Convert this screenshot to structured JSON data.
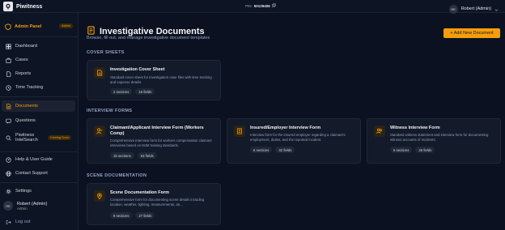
{
  "app": {
    "name": "Piwitness"
  },
  "pin": {
    "label": "PIN:",
    "value": "50129406"
  },
  "user": {
    "initials": "RE",
    "name": "Robert (Admin)"
  },
  "sidebar": {
    "admin_panel": {
      "label": "Admin Panel",
      "badge": "Admin"
    },
    "items": [
      {
        "label": "Dashboard",
        "icon": "dashboard-icon"
      },
      {
        "label": "Cases",
        "icon": "briefcase-icon"
      },
      {
        "label": "Reports",
        "icon": "file-icon"
      },
      {
        "label": "Time Tracking",
        "icon": "clock-icon"
      },
      {
        "label": "Documents",
        "icon": "document-icon",
        "active": true
      },
      {
        "label": "Questions",
        "icon": "question-icon"
      },
      {
        "label": "Piwitness IntelSearch",
        "icon": "search-icon",
        "badge": "Coming Soon"
      },
      {
        "label": "Help & User Guide",
        "icon": "help-icon"
      },
      {
        "label": "Contact Support",
        "icon": "globe-icon"
      },
      {
        "label": "Settings",
        "icon": "gear-icon"
      }
    ],
    "profile": {
      "initials": "RE",
      "name": "Robert (Admin)",
      "role": "Admin"
    },
    "logout": "Log out"
  },
  "main": {
    "title": "Investigative Documents",
    "subtitle": "Browse, fill out, and manage investigative document templates",
    "add_button": "+ Add New Document",
    "sections": [
      {
        "title": "COVER SHEETS",
        "cards": [
          {
            "title": "Investigation Cover Sheet",
            "desc": "Standard cover sheet for investigation case files with time tracking and expense details.",
            "sections": "4 sections",
            "fields": "16 fields",
            "icon": "document-icon"
          }
        ]
      },
      {
        "title": "INTERVIEW FORMS",
        "cards": [
          {
            "title": "Claimant/Applicant Interview Form (Workers Comp)",
            "desc": "Comprehensive interview form for workers compensation claimant interviews based on MJM training standards.",
            "sections": "15 sections",
            "fields": "63 fields",
            "icon": "user-edit-icon"
          },
          {
            "title": "Insured/Employer Interview Form",
            "desc": "Interview form for the insured employer regarding a claimant's employment, duties, and the reported incident.",
            "sections": "6 sections",
            "fields": "32 fields",
            "icon": "building-icon"
          },
          {
            "title": "Witness Interview Form",
            "desc": "Standard witness statement and interview form for documenting witness accounts of incidents.",
            "sections": "5 sections",
            "fields": "26 fields",
            "icon": "users-icon"
          }
        ]
      },
      {
        "title": "SCENE DOCUMENTATION",
        "cards": [
          {
            "title": "Scene Documentation Form",
            "desc": "Comprehensive form for documenting scene details including location, weather, lighting, measurements, an...",
            "sections": "8 sections",
            "fields": "27 fields",
            "icon": "map-pin-icon"
          }
        ]
      }
    ]
  },
  "colors": {
    "accent": "#f59e0b",
    "background": "#0b1120",
    "card": "#131a2a",
    "muted": "#93a3c4"
  }
}
